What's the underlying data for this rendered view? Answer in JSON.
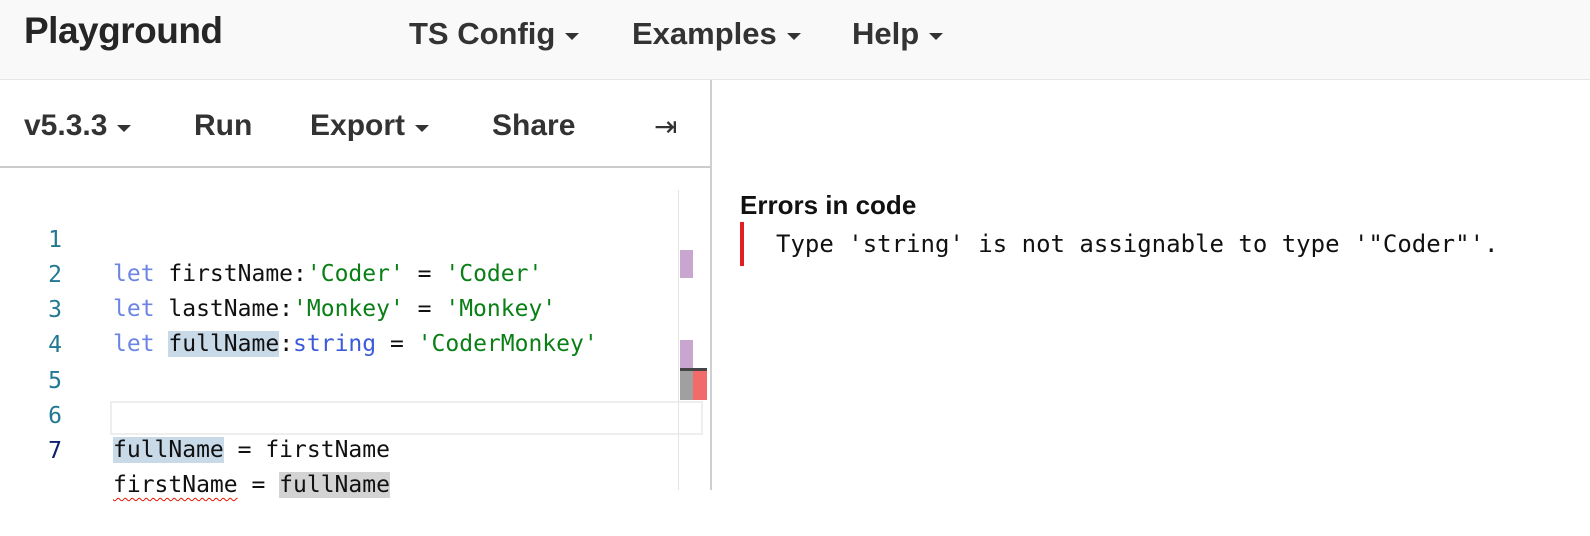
{
  "header": {
    "logo": "Playground",
    "menus": [
      {
        "label": "TS Config"
      },
      {
        "label": "Examples"
      },
      {
        "label": "Help"
      }
    ]
  },
  "toolbar": {
    "version_label": "v5.3.3",
    "run_label": "Run",
    "export_label": "Export",
    "share_label": "Share",
    "sidebar_toggle_icon": "collapse-right-icon"
  },
  "editor": {
    "lines": [
      {
        "number": "1",
        "kw": "let",
        "name": " firstName",
        "colon": ":",
        "annot": "'Coder'",
        "eq": " = ",
        "value": "'Coder'"
      },
      {
        "number": "2",
        "kw": "let",
        "name": " lastName",
        "colon": ":",
        "annot": "'Monkey'",
        "eq": " = ",
        "value": "'Monkey'"
      },
      {
        "number": "3",
        "kw": "let",
        "space": " ",
        "name_hl": "fullName",
        "colon": ":",
        "annot_type": "string",
        "eq": " = ",
        "value": "'CoderMonkey'"
      },
      {
        "number": "4"
      },
      {
        "number": "5"
      },
      {
        "number": "6",
        "lhs": "fullName",
        "eq": " = ",
        "rhs": "firstName"
      },
      {
        "number": "7",
        "lhs": "firstName",
        "eq": " = ",
        "rhs": "fullName"
      }
    ]
  },
  "errors": {
    "title": "Errors in code",
    "items": [
      "Type 'string' is not assignable to type '\"Coder\"'."
    ]
  },
  "colors": {
    "error": "#e02020",
    "ruler_highlight": "#c9a6cf",
    "ruler_error": "#f26b6b",
    "ruler_cursor": "#a0a0a0"
  }
}
